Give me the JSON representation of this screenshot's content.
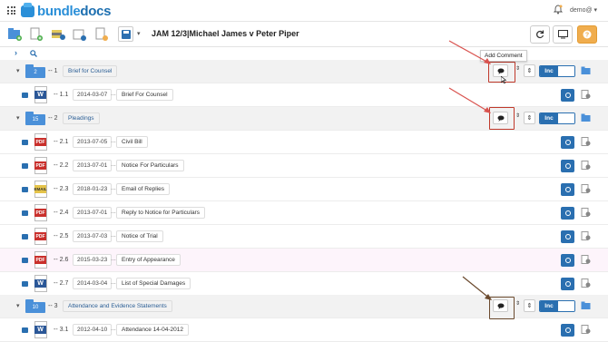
{
  "app": {
    "brand_part1": "bundle",
    "brand_part2": "docs",
    "user": "demo@ ▾"
  },
  "toolbar": {
    "title": "JAM 12/3|Michael James v Peter Piper",
    "caret": "▾"
  },
  "tooltip": "Add Comment",
  "colors": {
    "accent": "#2a6fb0",
    "highlight_red": "#c0392b",
    "highlight_brown": "#6b4a2e",
    "orange": "#f0ad4e"
  },
  "sections": [
    {
      "num": "1",
      "count": "2",
      "label": "Brief for Counsel",
      "inc": "Inc"
    },
    {
      "num": "2",
      "count": "15",
      "label": "Pleadings",
      "inc": "Inc"
    },
    {
      "num": "3",
      "count": "10",
      "label": "Attendance and Evidence Statements",
      "inc": "Inc"
    }
  ],
  "documents": [
    {
      "num": "1.1",
      "type": "word",
      "date": "2014-03-07",
      "label": "Brief For Counsel"
    },
    {
      "num": "2.1",
      "type": "pdf",
      "date": "2013-07-05",
      "label": "Civil Bill"
    },
    {
      "num": "2.2",
      "type": "pdf",
      "date": "2013-07-01",
      "label": "Notice For Particulars"
    },
    {
      "num": "2.3",
      "type": "email",
      "date": "2018-01-23",
      "label": "Email of Replies"
    },
    {
      "num": "2.4",
      "type": "pdf",
      "date": "2013-07-01",
      "label": "Reply to Notice for Particulars"
    },
    {
      "num": "2.5",
      "type": "pdf",
      "date": "2013-07-03",
      "label": "Notice of Trial"
    },
    {
      "num": "2.6",
      "type": "pdf",
      "date": "2015-03-23",
      "label": "Entry of Appearance"
    },
    {
      "num": "2.7",
      "type": "word",
      "date": "2014-03-04",
      "label": "List of Special Damages"
    },
    {
      "num": "3.1",
      "type": "word",
      "date": "2012-04-10",
      "label": "Attendance 14-04-2012"
    }
  ],
  "glyphs": {
    "ellipsis": "...",
    "dash": "--",
    "down_chev": "▾",
    "right_chev": "›",
    "updown": "⇕",
    "word": "W",
    "pdf": "PDF",
    "email": "EMAIL"
  }
}
